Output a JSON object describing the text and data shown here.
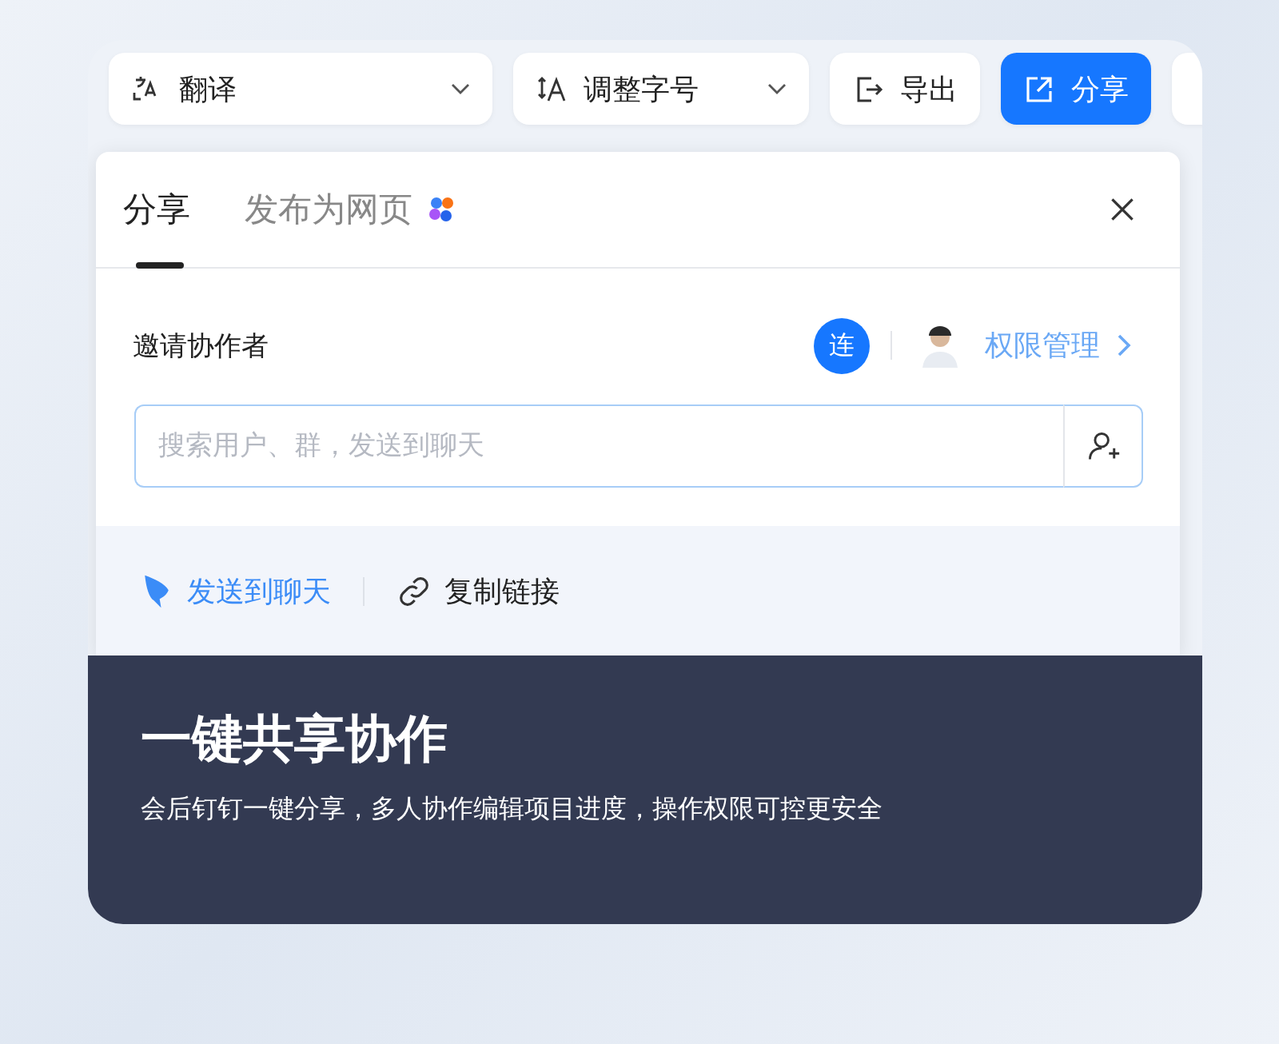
{
  "toolbar": [
    {
      "kind": "dropdown",
      "label": "翻译"
    },
    {
      "kind": "dropdown",
      "label": "调整字号"
    },
    {
      "kind": "button",
      "label": "导出"
    },
    {
      "kind": "primary",
      "label": "分享"
    }
  ],
  "share_panel": {
    "tabs": [
      {
        "label": "分享",
        "selected": true,
        "badge": false
      },
      {
        "label": "发布为网页",
        "selected": false,
        "badge": true
      }
    ],
    "invite_label": "邀请协作者",
    "collaborator_initial": "连",
    "permissions_link": "权限管理",
    "search": {
      "placeholder": "搜索用户、群，发送到聊天"
    },
    "actions": [
      {
        "kind": "send",
        "label": "发送到聊天"
      },
      {
        "kind": "link",
        "label": "复制链接"
      }
    ]
  },
  "caption": {
    "title": "一键共享协作",
    "subtitle": "会后钉钉一键分享，多人协作编辑项目进度，操作权限可控更安全"
  }
}
